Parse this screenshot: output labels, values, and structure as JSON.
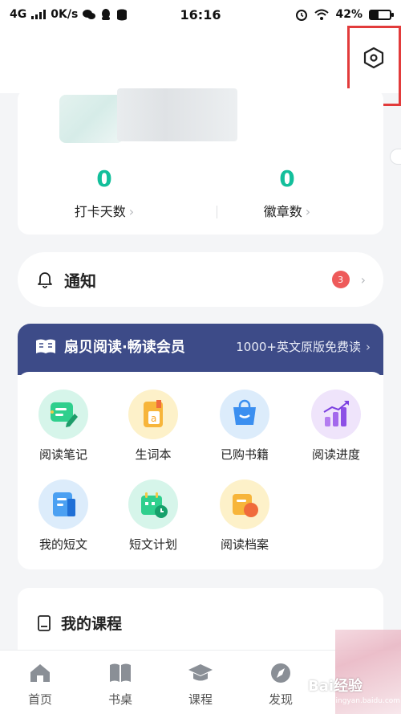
{
  "status_bar": {
    "network": "4G",
    "speed": "0K/s",
    "time": "16:16",
    "battery": "42%",
    "battery_fraction": 0.42
  },
  "profile": {
    "stats": [
      {
        "value": "0",
        "label": "打卡天数"
      },
      {
        "value": "0",
        "label": "徽章数"
      }
    ]
  },
  "notification": {
    "title": "通知",
    "count": "3"
  },
  "vip": {
    "title": "扇贝阅读·畅读会员",
    "subtitle": "1000+英文原版免费读",
    "items": [
      {
        "label": "阅读笔记",
        "icon": "reading-notes-icon"
      },
      {
        "label": "生词本",
        "icon": "vocabulary-book-icon"
      },
      {
        "label": "已购书籍",
        "icon": "purchased-books-icon"
      },
      {
        "label": "阅读进度",
        "icon": "reading-progress-icon"
      },
      {
        "label": "我的短文",
        "icon": "my-articles-icon"
      },
      {
        "label": "短文计划",
        "icon": "article-plan-icon"
      },
      {
        "label": "阅读档案",
        "icon": "reading-archive-icon"
      }
    ]
  },
  "courses": {
    "title": "我的课程"
  },
  "bottom_nav": [
    {
      "label": "首页",
      "icon": "home-icon"
    },
    {
      "label": "书桌",
      "icon": "book-desk-icon"
    },
    {
      "label": "课程",
      "icon": "course-cap-icon"
    },
    {
      "label": "发现",
      "icon": "compass-icon"
    }
  ],
  "watermark": {
    "text": "Bai经验",
    "sub": "jingyan.baidu.com"
  },
  "colors": {
    "accent_green": "#13bf9b",
    "vip_blue": "#3d4b88",
    "badge_red": "#ee5a5a",
    "highlight_red": "#e23b3b"
  }
}
